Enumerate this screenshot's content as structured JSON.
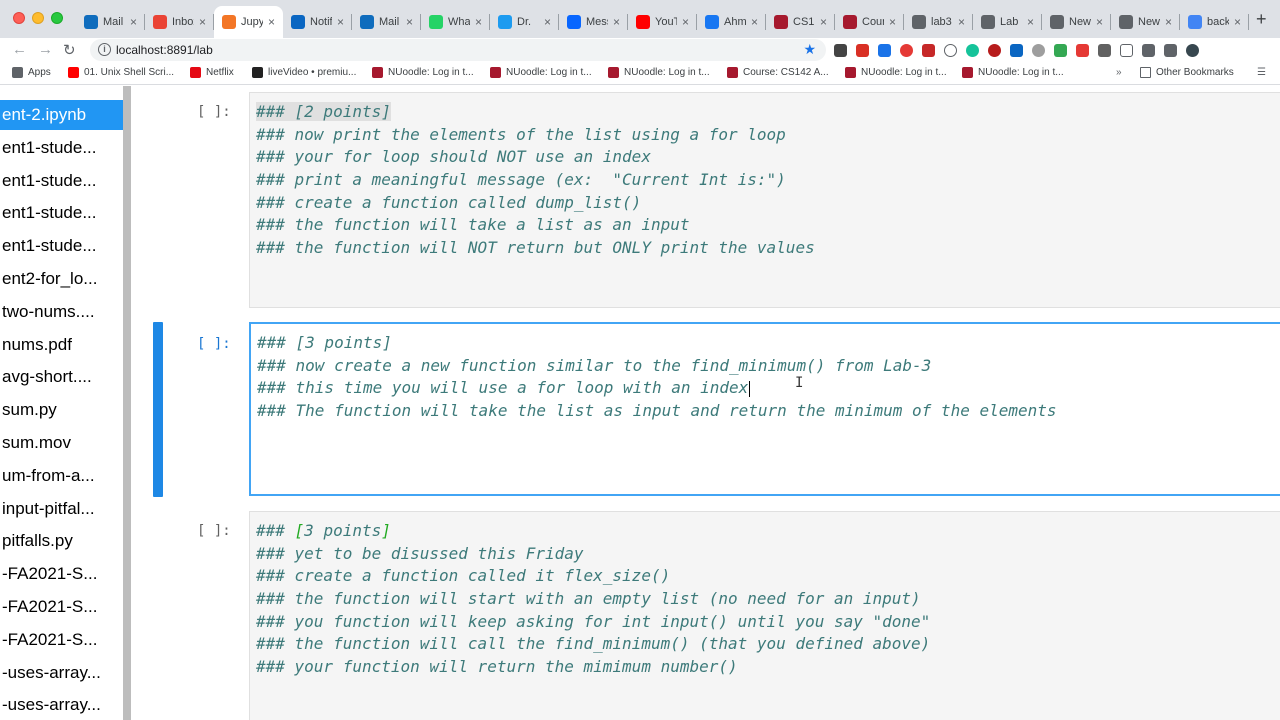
{
  "browser": {
    "tabs": [
      {
        "title": "Mail",
        "icon": "outlook-icon",
        "color": "#0f6cbd"
      },
      {
        "title": "Inbox",
        "icon": "gmail-icon",
        "color": "#ea4335"
      },
      {
        "title": "Jupyter",
        "icon": "jupyter-icon",
        "color": "#f37626",
        "active": true
      },
      {
        "title": "Notifications",
        "icon": "linkedin-icon",
        "color": "#0a66c2"
      },
      {
        "title": "Mail",
        "icon": "outlook-icon",
        "color": "#0f6cbd"
      },
      {
        "title": "WhatsApp",
        "icon": "whatsapp-icon",
        "color": "#25d366"
      },
      {
        "title": "Dr. ",
        "icon": "twitter-icon",
        "color": "#1d9bf0"
      },
      {
        "title": "Messenger",
        "icon": "messenger-icon",
        "color": "#0866ff"
      },
      {
        "title": "YouTube",
        "icon": "youtube-icon",
        "color": "#ff0000"
      },
      {
        "title": "Ahmed",
        "icon": "facebook-icon",
        "color": "#1877f2"
      },
      {
        "title": "CS1",
        "icon": "moodle-icon",
        "color": "#a6192e"
      },
      {
        "title": "Course",
        "icon": "moodle-icon",
        "color": "#a6192e"
      },
      {
        "title": "lab3",
        "icon": "globe-icon",
        "color": "#5f6368"
      },
      {
        "title": "Lab",
        "icon": "globe-icon",
        "color": "#5f6368"
      },
      {
        "title": "New",
        "icon": "chrome-icon",
        "color": "#5f6368"
      },
      {
        "title": "New",
        "icon": "chrome-icon",
        "color": "#5f6368"
      },
      {
        "title": "back",
        "icon": "google-icon",
        "color": "#4285f4"
      }
    ],
    "url": "localhost:8891/lab",
    "bookmarks": [
      {
        "label": "Apps",
        "icon": "apps-grid-icon",
        "color": "#5f6368"
      },
      {
        "label": "01. Unix Shell Scri...",
        "icon": "youtube-icon",
        "color": "#ff0000"
      },
      {
        "label": "Netflix",
        "icon": "netflix-icon",
        "color": "#e50914"
      },
      {
        "label": "liveVideo • premiu...",
        "icon": "manning-icon",
        "color": "#222222"
      },
      {
        "label": "NUoodle: Log in t...",
        "icon": "moodle-icon",
        "color": "#a6192e"
      },
      {
        "label": "NUoodle: Log in t...",
        "icon": "moodle-icon",
        "color": "#a6192e"
      },
      {
        "label": "NUoodle: Log in t...",
        "icon": "moodle-icon",
        "color": "#a6192e"
      },
      {
        "label": "Course: CS142 A...",
        "icon": "moodle-icon",
        "color": "#a6192e"
      },
      {
        "label": "NUoodle: Log in t...",
        "icon": "moodle-icon",
        "color": "#a6192e"
      },
      {
        "label": "NUoodle: Log in t...",
        "icon": "moodle-icon",
        "color": "#a6192e"
      }
    ],
    "more_bookmarks": "»",
    "other_bookmarks": "Other Bookmarks"
  },
  "files": [
    "ent-2.ipynb",
    "ent1-stude...",
    "ent1-stude...",
    "ent1-stude...",
    "ent1-stude...",
    "ent2-for_lo...",
    "two-nums....",
    "nums.pdf",
    "avg-short....",
    "sum.py",
    "sum.mov",
    "um-from-a...",
    "input-pitfal...",
    "pitfalls.py",
    "-FA2021-S...",
    "-FA2021-S...",
    "-FA2021-S...",
    "-uses-array...",
    "-uses-array..."
  ],
  "cells": [
    {
      "prompt": "[ ]:",
      "lines": [
        "### [2 points]",
        "### now print the elements of the list using a for loop",
        "### your for loop should NOT use an index",
        "### print a meaningful message (ex:  \"Current Int is:\")",
        "### create a function called dump_list()",
        "### the function will take a list as an input",
        "### the function will NOT return but ONLY print the values"
      ]
    },
    {
      "prompt": "[ ]:",
      "lines": [
        "### [3 points]",
        "### now create a new function similar to the find_minimum() from Lab-3",
        "### this time you will use a for loop with an index",
        "### The function will take the list as input and return the minimum of the elements"
      ]
    },
    {
      "prompt": "[ ]:",
      "lines": [
        "### [3 points]",
        "### yet to be disussed this Friday",
        "### create a function called it flex_size()",
        "### the function will start with an empty list (no need for an input)",
        "### you function will keep asking for int input() until you say \"done\"",
        "### the function will call the find_minimum() (that you defined above)",
        "### your function will return the mimimum number()"
      ]
    }
  ]
}
